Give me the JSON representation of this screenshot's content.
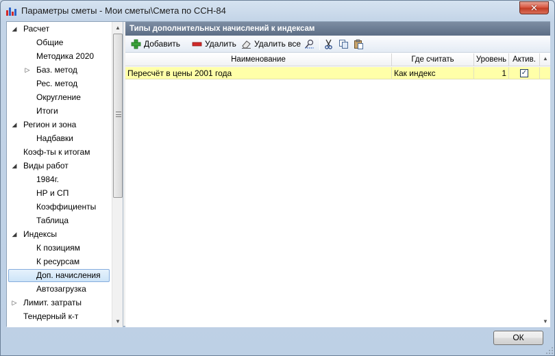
{
  "window": {
    "title": "Параметры сметы - Мои сметы\\Смета по ССН-84",
    "close_label": "✕"
  },
  "tree": {
    "items": [
      {
        "label": "Расчет",
        "level": 0,
        "arrow": "expanded"
      },
      {
        "label": "Общие",
        "level": 1,
        "arrow": "none"
      },
      {
        "label": "Методика 2020",
        "level": 1,
        "arrow": "none"
      },
      {
        "label": "Баз. метод",
        "level": 1,
        "arrow": "collapsed"
      },
      {
        "label": "Рес. метод",
        "level": 1,
        "arrow": "none"
      },
      {
        "label": "Округление",
        "level": 1,
        "arrow": "none"
      },
      {
        "label": "Итоги",
        "level": 1,
        "arrow": "none"
      },
      {
        "label": "Регион и зона",
        "level": 0,
        "arrow": "expanded"
      },
      {
        "label": "Надбавки",
        "level": 1,
        "arrow": "none"
      },
      {
        "label": "Коэф-ты к итогам",
        "level": 0,
        "arrow": "none"
      },
      {
        "label": "Виды работ",
        "level": 0,
        "arrow": "expanded"
      },
      {
        "label": "1984г.",
        "level": 1,
        "arrow": "none"
      },
      {
        "label": "НР и СП",
        "level": 1,
        "arrow": "none"
      },
      {
        "label": "Коэффициенты",
        "level": 1,
        "arrow": "none"
      },
      {
        "label": "Таблица",
        "level": 1,
        "arrow": "none"
      },
      {
        "label": "Индексы",
        "level": 0,
        "arrow": "expanded"
      },
      {
        "label": "К позициям",
        "level": 1,
        "arrow": "none"
      },
      {
        "label": "К ресурсам",
        "level": 1,
        "arrow": "none"
      },
      {
        "label": "Доп. начисления",
        "level": 1,
        "arrow": "none",
        "selected": true
      },
      {
        "label": "Автозагрузка",
        "level": 1,
        "arrow": "none"
      },
      {
        "label": "Лимит. затраты",
        "level": 0,
        "arrow": "collapsed"
      },
      {
        "label": "Тендерный к-т",
        "level": 0,
        "arrow": "none"
      }
    ]
  },
  "panel": {
    "header": "Типы дополнительных начислений к индексам",
    "toolbar": {
      "add_label": "Добавить",
      "delete_label": "Удалить",
      "delete_all_label": "Удалить все"
    },
    "columns": [
      "Наименование",
      "Где считать",
      "Уровень",
      "Актив."
    ],
    "rows": [
      {
        "name": "Пересчёт в цены 2001 года",
        "where": "Как индекс",
        "level": "1",
        "active": true
      }
    ]
  },
  "footer": {
    "ok_label": "ОК"
  },
  "colors": {
    "row_highlight": "#ffffa8",
    "header_bar": "#5c6d85",
    "close_button": "#c13a23"
  }
}
